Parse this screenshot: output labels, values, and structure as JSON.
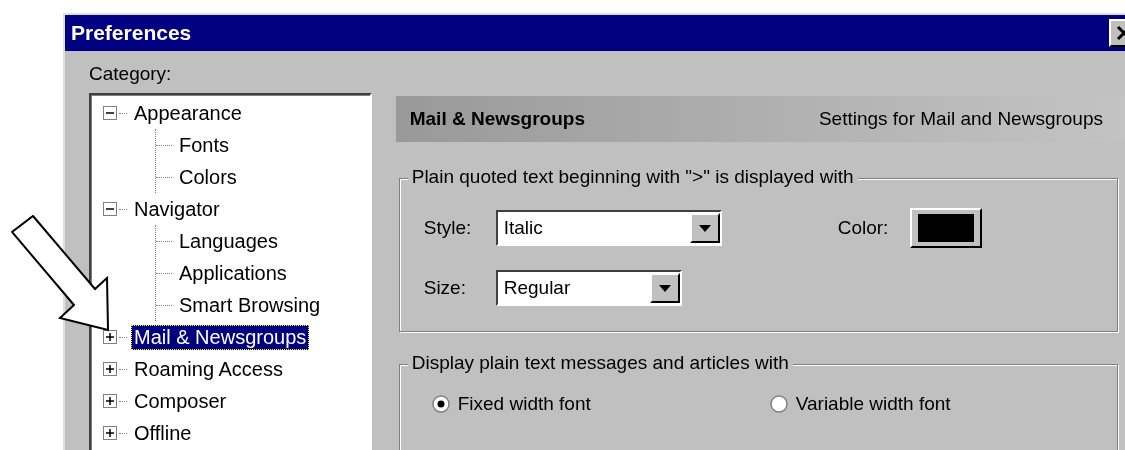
{
  "window": {
    "title": "Preferences"
  },
  "category_label": "Category:",
  "tree": [
    {
      "label": "Appearance",
      "expanded": true,
      "selected": false,
      "children": [
        {
          "label": "Fonts",
          "selected": false
        },
        {
          "label": "Colors",
          "selected": false
        }
      ]
    },
    {
      "label": "Navigator",
      "expanded": true,
      "selected": false,
      "children": [
        {
          "label": "Languages",
          "selected": false
        },
        {
          "label": "Applications",
          "selected": false
        },
        {
          "label": "Smart Browsing",
          "selected": false
        }
      ]
    },
    {
      "label": "Mail & Newsgroups",
      "expanded": false,
      "selected": true
    },
    {
      "label": "Roaming Access",
      "expanded": false,
      "selected": false
    },
    {
      "label": "Composer",
      "expanded": false,
      "selected": false
    },
    {
      "label": "Offline",
      "expanded": false,
      "selected": false
    }
  ],
  "header": {
    "title": "Mail & Newsgroups",
    "subtitle": "Settings for Mail and Newsgroups"
  },
  "quoted_group": {
    "legend": "Plain quoted text beginning with \">\" is displayed with",
    "style": {
      "label": "Style:",
      "value": "Italic"
    },
    "size": {
      "label": "Size:",
      "value": "Regular"
    },
    "color": {
      "label": "Color:",
      "color": "#000000"
    }
  },
  "display_group": {
    "legend": "Display plain text messages and articles with",
    "options": [
      {
        "label": "Fixed width font",
        "selected": true
      },
      {
        "label": "Variable width font",
        "selected": false
      }
    ]
  }
}
